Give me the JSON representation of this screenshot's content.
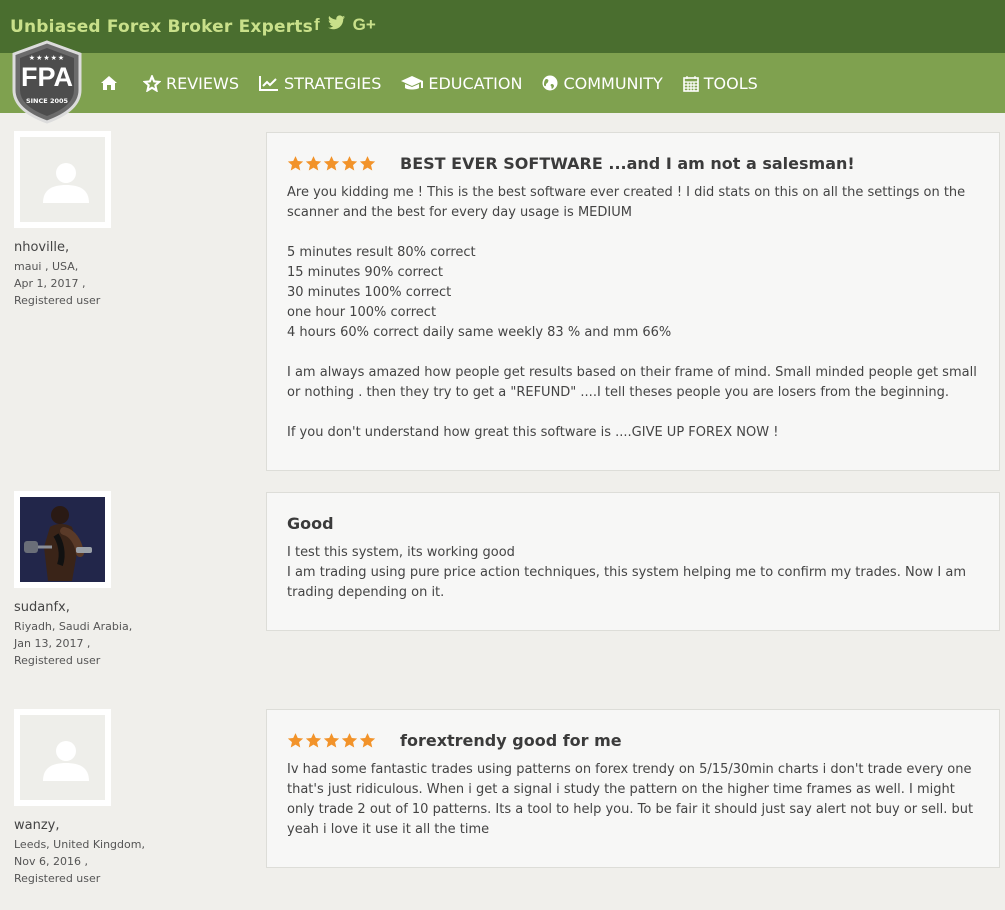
{
  "header": {
    "site_title": "Unbiased Forex Broker Experts",
    "social": [
      {
        "icon": "facebook-icon",
        "glyph": "f"
      },
      {
        "icon": "twitter-icon",
        "glyph": "t"
      },
      {
        "icon": "google-plus-icon",
        "glyph": "G+"
      }
    ],
    "logo": {
      "text": "FPA",
      "since": "SINCE 2005",
      "stars": "★★★★★"
    }
  },
  "nav": {
    "items": [
      {
        "label": "",
        "icon": "home-icon"
      },
      {
        "label": "REVIEWS",
        "icon": "star-icon"
      },
      {
        "label": "STRATEGIES",
        "icon": "chart-icon"
      },
      {
        "label": "EDUCATION",
        "icon": "graduation-cap-icon"
      },
      {
        "label": "COMMUNITY",
        "icon": "globe-icon"
      },
      {
        "label": "TOOLS",
        "icon": "calendar-icon"
      }
    ]
  },
  "colors": {
    "topbar": "#4a6e2f",
    "navbar": "#7fa14f",
    "title_text": "#c9e08a",
    "star": "#f2932a"
  },
  "reviews": [
    {
      "username": "nhoville,",
      "location": "maui , USA,",
      "date": "Apr 1, 2017 ,",
      "role": "Registered user",
      "avatar": "default-avatar",
      "rating": 5,
      "title": "BEST EVER SOFTWARE ...and I am not a salesman!",
      "paragraphs": [
        "Are you kidding me ! This is the best software ever created ! I did stats on this on all the settings on the scanner and the best for every day usage is MEDIUM",
        "5 minutes result 80% correct\n15 minutes 90% correct\n30 minutes 100% correct\none hour 100% correct\n4 hours 60% correct daily same weekly 83 % and mm 66%",
        "I am always amazed how people get results based on their frame of mind. Small minded people get small or nothing . then they try to get a \"REFUND\" ....I tell theses people you are losers from the beginning.",
        "If you don't understand how great this software is ....GIVE UP FOREX NOW !"
      ]
    },
    {
      "username": "sudanfx,",
      "location": "Riyadh, Saudi Arabia,",
      "date": "Jan 13, 2017 ,",
      "role": "Registered user",
      "avatar": "photo-avatar",
      "rating": 0,
      "title": "Good",
      "paragraphs": [
        "I test this system, its working good\nI am trading using pure price action techniques, this system helping me to confirm my trades. Now I am trading depending on it."
      ]
    },
    {
      "username": "wanzy,",
      "location": "Leeds, United Kingdom,",
      "date": "Nov 6, 2016 ,",
      "role": "Registered user",
      "avatar": "default-avatar",
      "rating": 5,
      "title": "forextrendy good for me",
      "paragraphs": [
        "Iv had some fantastic trades using patterns on forex trendy on 5/15/30min charts i don't trade every one that's just ridiculous. When i get a signal i study the pattern on the higher time frames as well. I might only trade 2 out of 10 patterns. Its a tool to help you. To be fair it should just say alert not buy or sell. but yeah i love it use it all the time"
      ]
    }
  ]
}
